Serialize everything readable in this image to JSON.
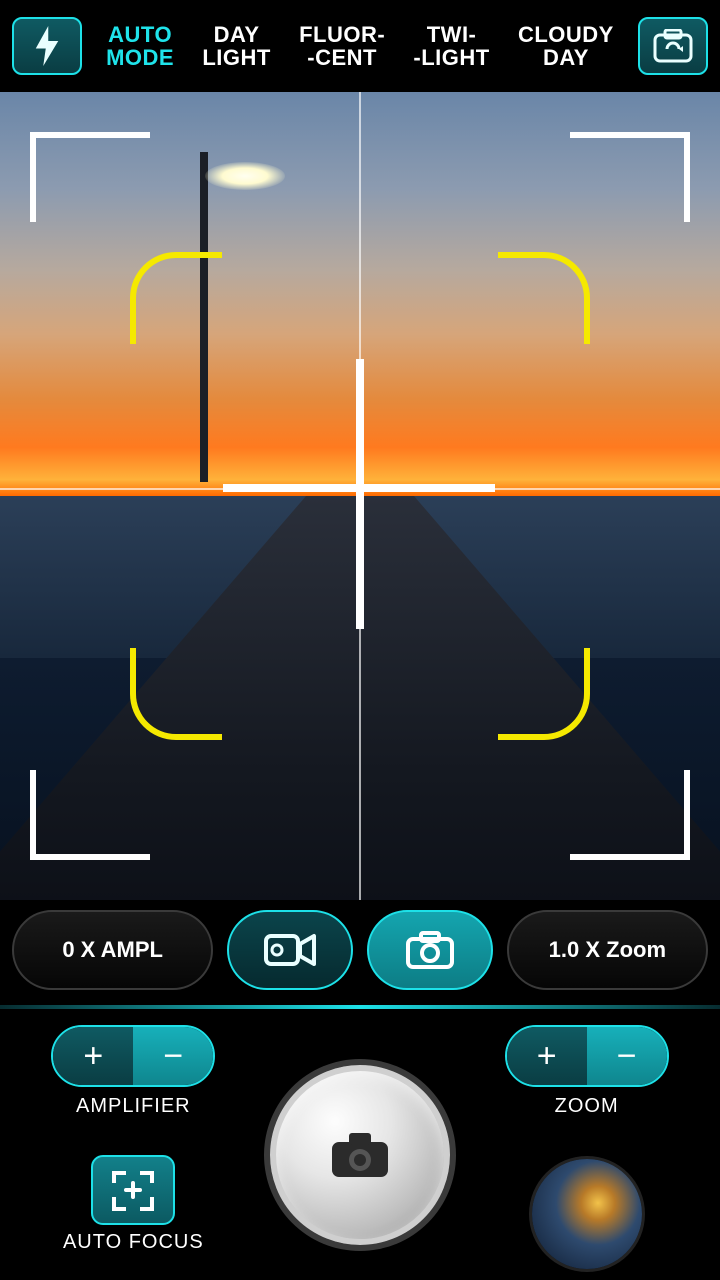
{
  "topbar": {
    "modes": [
      {
        "line1": "AUTO",
        "line2": "MODE",
        "active": true
      },
      {
        "line1": "DAY",
        "line2": "LIGHT",
        "active": false
      },
      {
        "line1": "FLUOR-",
        "line2": "-CENT",
        "active": false
      },
      {
        "line1": "TWI-",
        "line2": "-LIGHT",
        "active": false
      },
      {
        "line1": "CLOUDY",
        "line2": "DAY",
        "active": false
      }
    ]
  },
  "midbar": {
    "ampl_label": "0 X AMPL",
    "zoom_label": "1.0 X Zoom"
  },
  "bottom": {
    "amplifier_label": "AMPLIFIER",
    "zoom_label": "ZOOM",
    "autofocus_label": "AUTO FOCUS"
  }
}
